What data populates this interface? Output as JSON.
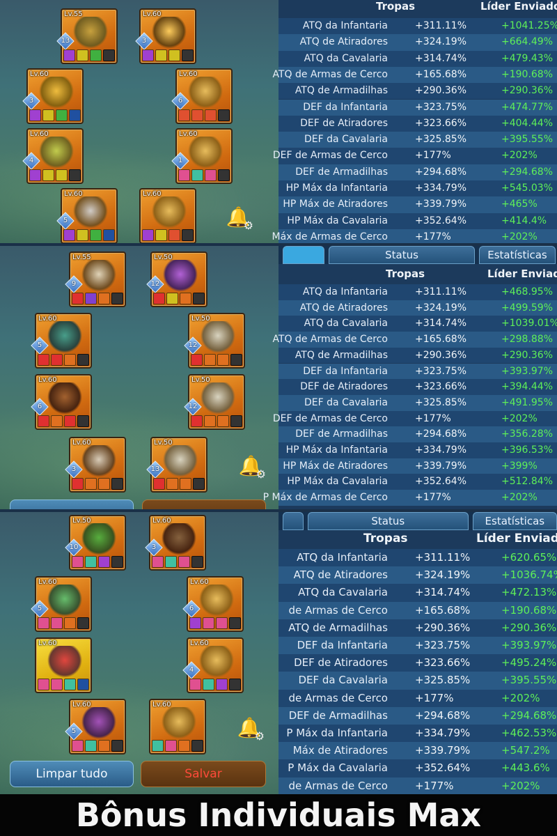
{
  "labels": {
    "tropas": "Tropas",
    "lider": "Líder Enviado",
    "status": "Status",
    "estatisticas": "Estatísticas"
  },
  "buttons": {
    "clear": "Limpar tudo",
    "save": "Salvar"
  },
  "caption": "Bônus Individuais Max",
  "colors": {
    "leader_value": "#5ef058",
    "save_text": "#ff4a3a",
    "slot_orange": "#e08020"
  },
  "panels": [
    {
      "slots": [
        {
          "level": "Lv.55",
          "rank": "13"
        },
        {
          "level": "Lv.60",
          "rank": "3"
        },
        {
          "level": "Lv.60",
          "rank": "3"
        },
        {
          "level": "Lv.60",
          "rank": "6"
        },
        {
          "level": "Lv.60",
          "rank": "4"
        },
        {
          "level": "Lv.60",
          "rank": "1"
        },
        {
          "level": "Lv.60",
          "rank": "5"
        },
        {
          "level": "Lv.60"
        }
      ],
      "stats": [
        {
          "name": "ATQ da Infantaria",
          "troops": "+311.11%",
          "leader": "+1041.25%"
        },
        {
          "name": "ATQ de Atiradores",
          "troops": "+324.19%",
          "leader": "+664.49%"
        },
        {
          "name": "ATQ da Cavalaria",
          "troops": "+314.74%",
          "leader": "+479.43%"
        },
        {
          "name": "ATQ de Armas de Cerco",
          "troops": "+165.68%",
          "leader": "+190.68%"
        },
        {
          "name": "ATQ de Armadilhas",
          "troops": "+290.36%",
          "leader": "+290.36%"
        },
        {
          "name": "DEF da Infantaria",
          "troops": "+323.75%",
          "leader": "+474.77%"
        },
        {
          "name": "DEF de Atiradores",
          "troops": "+323.66%",
          "leader": "+404.44%"
        },
        {
          "name": "DEF da Cavalaria",
          "troops": "+325.85%",
          "leader": "+395.55%"
        },
        {
          "name": "DEF de Armas de Cerco",
          "troops": "+177%",
          "leader": "+202%"
        },
        {
          "name": "DEF de Armadilhas",
          "troops": "+294.68%",
          "leader": "+294.68%"
        },
        {
          "name": "HP Máx da Infantaria",
          "troops": "+334.79%",
          "leader": "+545.03%"
        },
        {
          "name": "HP Máx de Atiradores",
          "troops": "+339.79%",
          "leader": "+465%"
        },
        {
          "name": "HP Máx da Cavalaria",
          "troops": "+352.64%",
          "leader": "+414.4%"
        },
        {
          "name": "Máx de Armas de Cerco",
          "troops": "+177%",
          "leader": "+202%"
        }
      ]
    },
    {
      "slots": [
        {
          "level": "Lv.55",
          "rank": "9"
        },
        {
          "level": "Lv.50",
          "rank": "12"
        },
        {
          "level": "Lv.60",
          "rank": "5"
        },
        {
          "level": "Lv.50",
          "rank": "12"
        },
        {
          "level": "Lv.60",
          "rank": "6"
        },
        {
          "level": "Lv.50",
          "rank": "12"
        },
        {
          "level": "Lv.60",
          "rank": "3"
        },
        {
          "level": "Lv.50",
          "rank": "13"
        }
      ],
      "stats": [
        {
          "name": "ATQ da Infantaria",
          "troops": "+311.11%",
          "leader": "+468.95%"
        },
        {
          "name": "ATQ de Atiradores",
          "troops": "+324.19%",
          "leader": "+499.59%"
        },
        {
          "name": "ATQ da Cavalaria",
          "troops": "+314.74%",
          "leader": "+1039.01%"
        },
        {
          "name": "ATQ de Armas de Cerco",
          "troops": "+165.68%",
          "leader": "+298.88%"
        },
        {
          "name": "ATQ de Armadilhas",
          "troops": "+290.36%",
          "leader": "+290.36%"
        },
        {
          "name": "DEF da Infantaria",
          "troops": "+323.75%",
          "leader": "+393.97%"
        },
        {
          "name": "DEF de Atiradores",
          "troops": "+323.66%",
          "leader": "+394.44%"
        },
        {
          "name": "DEF da Cavalaria",
          "troops": "+325.85%",
          "leader": "+491.95%"
        },
        {
          "name": "DEF de Armas de Cerco",
          "troops": "+177%",
          "leader": "+202%"
        },
        {
          "name": "DEF de Armadilhas",
          "troops": "+294.68%",
          "leader": "+356.28%"
        },
        {
          "name": "HP Máx da Infantaria",
          "troops": "+334.79%",
          "leader": "+396.53%"
        },
        {
          "name": "HP Máx de Atiradores",
          "troops": "+339.79%",
          "leader": "+399%"
        },
        {
          "name": "HP Máx da Cavalaria",
          "troops": "+352.64%",
          "leader": "+512.84%"
        },
        {
          "name": "P Máx de Armas de Cerco",
          "troops": "+177%",
          "leader": "+202%"
        }
      ]
    },
    {
      "slots": [
        {
          "level": "Lv.50",
          "rank": "10"
        },
        {
          "level": "Lv.60",
          "rank": "3"
        },
        {
          "level": "Lv.60",
          "rank": "5"
        },
        {
          "level": "Lv.60",
          "rank": "6"
        },
        {
          "level": "Lv.60"
        },
        {
          "level": "Lv.60",
          "rank": "4"
        },
        {
          "level": "Lv.60",
          "rank": "5"
        },
        {
          "level": "Lv.60"
        }
      ],
      "stats": [
        {
          "name": "ATQ da Infantaria",
          "troops": "+311.11%",
          "leader": "+620.65%"
        },
        {
          "name": "ATQ de Atiradores",
          "troops": "+324.19%",
          "leader": "+1036.74%"
        },
        {
          "name": "ATQ da Cavalaria",
          "troops": "+314.74%",
          "leader": "+472.13%"
        },
        {
          "name": "de Armas de Cerco",
          "troops": "+165.68%",
          "leader": "+190.68%"
        },
        {
          "name": "ATQ de Armadilhas",
          "troops": "+290.36%",
          "leader": "+290.36%"
        },
        {
          "name": "DEF da Infantaria",
          "troops": "+323.75%",
          "leader": "+393.97%"
        },
        {
          "name": "DEF de Atiradores",
          "troops": "+323.66%",
          "leader": "+495.24%"
        },
        {
          "name": "DEF da Cavalaria",
          "troops": "+325.85%",
          "leader": "+395.55%"
        },
        {
          "name": "de Armas de Cerco",
          "troops": "+177%",
          "leader": "+202%"
        },
        {
          "name": "DEF de Armadilhas",
          "troops": "+294.68%",
          "leader": "+294.68%"
        },
        {
          "name": "P Máx da Infantaria",
          "troops": "+334.79%",
          "leader": "+462.53%"
        },
        {
          "name": "Máx de Atiradores",
          "troops": "+339.79%",
          "leader": "+547.2%"
        },
        {
          "name": "P Máx da Cavalaria",
          "troops": "+352.64%",
          "leader": "+443.6%"
        },
        {
          "name": "de Armas de Cerco",
          "troops": "+177%",
          "leader": "+202%"
        }
      ]
    }
  ]
}
